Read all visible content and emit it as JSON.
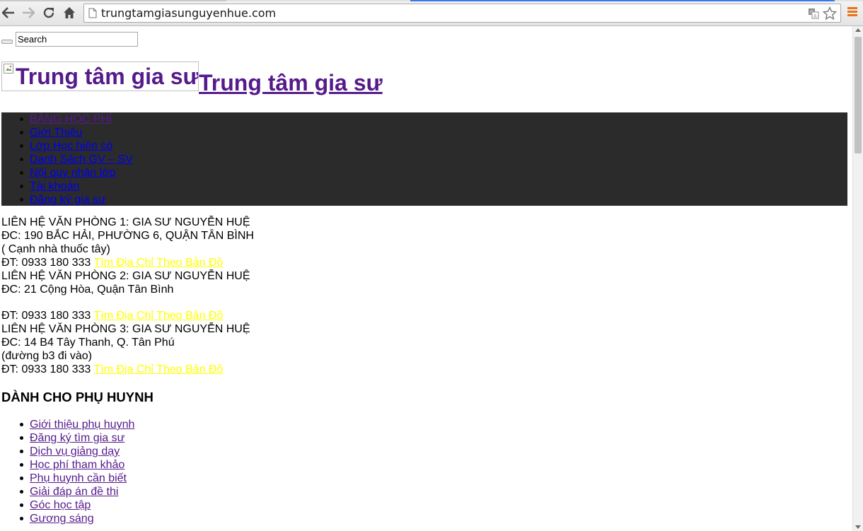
{
  "browser": {
    "url": "trungtamgiasunguyenhue.com",
    "icons": {
      "back": "back-arrow-icon",
      "forward": "forward-arrow-icon",
      "reload": "reload-icon",
      "home": "home-icon",
      "page": "page-icon",
      "translate": "translate-icon",
      "bookmark": "star-icon",
      "menu": "menu-icon"
    },
    "menu_color": "#e8731a"
  },
  "search": {
    "input_value": "Search"
  },
  "header": {
    "logo_alt": "Trung tâm gia sư",
    "site_title": "Trung tâm gia sư"
  },
  "nav": {
    "background": "#2b2b2b",
    "items": [
      {
        "label": "BẢNG HỌC PHÍ",
        "color": "#551a8b"
      },
      {
        "label": "Giới Thiệu",
        "color": "#0000ee"
      },
      {
        "label": "Lớp Học hiện có",
        "color": "#0000ee"
      },
      {
        "label": "Danh Sách GV – SV",
        "color": "#0000ee"
      },
      {
        "label": "Nội quy nhận lớp",
        "color": "#0000ee"
      },
      {
        "label": "Tài khoản",
        "color": "#0000ee"
      },
      {
        "label": "Đăng ký gia sư",
        "color": "#0000ee"
      }
    ]
  },
  "contacts": {
    "link_color": "#ffff00",
    "office1": {
      "title": "LIÊN HỆ VĂN PHÒNG 1: GIA SƯ NGUYỄN HUỆ",
      "address": "ĐC: 190 BẮC HẢI, PHƯỜNG 6, QUẬN TÂN BÌNH",
      "note": "( Cạnh nhà thuốc tây)",
      "phone": "ĐT: 0933 180 333",
      "map_link": "Tìm Địa Chỉ Theo Bản Đồ"
    },
    "office2": {
      "title": "LIÊN HỆ VĂN PHÒNG 2: GIA SƯ NGUYỄN HUỆ",
      "address": "ĐC: 21 Cộng Hòa, Quận Tân Bình",
      "phone": "ĐT: 0933 180 333",
      "map_link": "Tìm Địa Chỉ Theo Bản Đồ"
    },
    "office3": {
      "title": "LIÊN HỆ VĂN PHÒNG 3: GIA SƯ NGUYỄN HUỆ",
      "address": "ĐC: 14 B4 Tây Thanh, Q. Tân Phú",
      "note": "(đường b3 đi vào)",
      "phone": "ĐT: 0933 180 333",
      "map_link": "Tìm Địa Chỉ Theo Bản Đồ"
    }
  },
  "parents_section": {
    "heading": "DÀNH CHO PHỤ HUYNH",
    "items": [
      "Giới thiệu phụ huynh",
      "Đăng ký tìm gia sư",
      "Dịch vụ giảng dạy",
      "Học phí tham khảo",
      "Phụ huynh cần biết",
      "Giải đáp án đề thi",
      "Góc học tập",
      "Gương sáng"
    ]
  }
}
